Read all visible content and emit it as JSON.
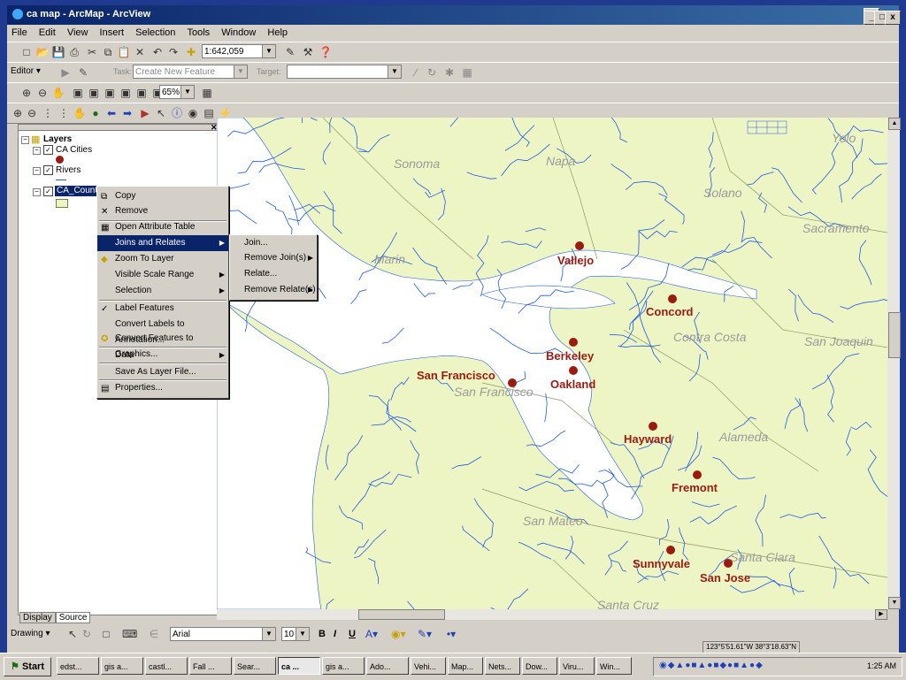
{
  "window": {
    "title": "ca map - ArcMap - ArcView",
    "min": "_",
    "max": "□",
    "close": "x"
  },
  "menubar": [
    "File",
    "Edit",
    "View",
    "Insert",
    "Selection",
    "Tools",
    "Window",
    "Help"
  ],
  "standard_toolbar": {
    "scale": "1:642,059"
  },
  "editor_toolbar": {
    "editor": "Editor ▾",
    "task_label": "Task:",
    "task_value": "Create New Feature",
    "target_label": "Target:"
  },
  "layout_toolbar": {
    "zoom": "65%"
  },
  "toc": {
    "root": "Layers",
    "layers": [
      {
        "name": "CA Cities",
        "checked": true
      },
      {
        "name": "Rivers",
        "checked": true
      },
      {
        "name": "CA_Counties",
        "checked": true,
        "selected": true
      }
    ],
    "tabs": [
      "Display",
      "Source"
    ]
  },
  "context_menu": {
    "items": [
      "Copy",
      "Remove",
      "Open Attribute Table",
      "Joins and Relates",
      "Zoom To Layer",
      "Visible Scale Range",
      "Selection",
      "Label Features",
      "Convert Labels to Annotation...",
      "Convert Features to Graphics...",
      "Data",
      "Save As Layer File...",
      "Properties..."
    ],
    "highlighted": "Joins and Relates",
    "submenu": [
      "Join...",
      "Remove Join(s)",
      "Relate...",
      "Remove Relate(s)"
    ]
  },
  "map": {
    "cities": [
      "Vallejo",
      "Concord",
      "Berkeley",
      "Oakland",
      "San Francisco",
      "Hayward",
      "Fremont",
      "Sunnyvale",
      "San Jose"
    ],
    "counties": [
      "Yolo",
      "Sonoma",
      "Napa",
      "Solano",
      "Sacramento",
      "Marin",
      "Contra Costa",
      "San Joaquin",
      "San Francisco",
      "Alameda",
      "San Mateo",
      "Santa Clara",
      "Santa Cruz"
    ],
    "colors": {
      "land": "#eef5c4",
      "water": "#ffffff",
      "river": "#1e5be6",
      "city": "#9b1b10",
      "county_label": "#9a9a9a"
    }
  },
  "drawing_toolbar": {
    "drawing": "Drawing ▾",
    "font": "Arial",
    "size": "10",
    "bold": "B",
    "italic": "I",
    "underline": "U"
  },
  "status": {
    "coords": "123°5'51.61\"W  38°3'18.63\"N"
  },
  "taskbar": {
    "start": "Start",
    "tasks": [
      "edst...",
      "gis a...",
      "castl...",
      "Fall ...",
      "Sear...",
      "ca ...",
      "gis a...",
      "Ado...",
      "Vehi...",
      "Map...",
      "Nets...",
      "Dow...",
      "Viru...",
      "Win..."
    ],
    "active": "ca ...",
    "clock": "1:25 AM"
  }
}
